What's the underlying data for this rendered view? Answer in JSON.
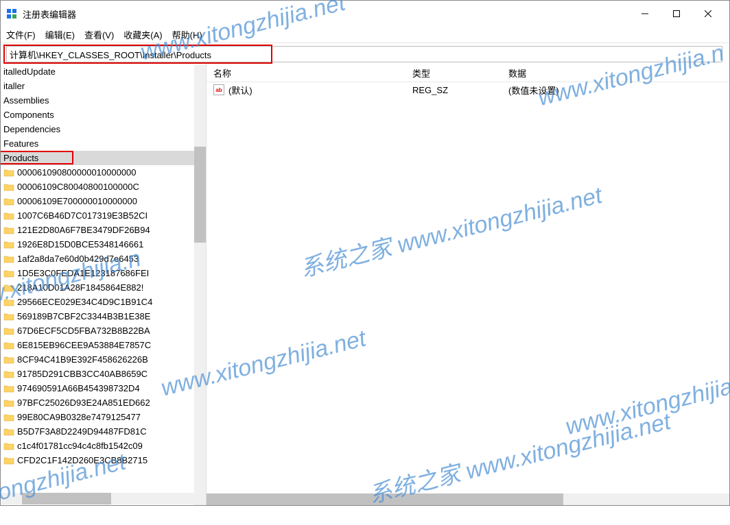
{
  "window": {
    "title": "注册表编辑器"
  },
  "menus": {
    "file": "文件(F)",
    "edit": "编辑(E)",
    "view": "查看(V)",
    "fav": "收藏夹(A)",
    "help": "帮助(H)"
  },
  "address": "计算机\\HKEY_CLASSES_ROOT\\Installer\\Products",
  "tree": {
    "top_partial1": "italledUpdate",
    "top_partial2": "italler",
    "items": [
      "Assemblies",
      "Components",
      "Dependencies",
      "Features",
      "Products"
    ],
    "children": [
      "000061090800000010000000",
      "00006109C80040800100000C",
      "00006109E700000010000000",
      "1007C6B46D7C017319E3B52CI",
      "121E2D80A6F7BE3479DF26B94",
      "1926E8D15D0BCE5348146661",
      "1af2a8da7e60d0b429d7e6453",
      "1D5E3C0FEDA1E123187686FEI",
      "218A10D01A28F1845864E882!",
      "29566ECE029E34C4D9C1B91C4",
      "569189B7CBF2C3344B3B1E38E",
      "67D6ECF5CD5FBA732B8B22BA",
      "6E815EB96CEE9A53884E7857C",
      "8CF94C41B9E392F458626226B",
      "91785D291CBB3CC40AB8659C",
      "974690591A66B454398732D4",
      "97BFC25026D93E24A851ED662",
      "99E80CA9B0328e7479125477",
      "B5D7F3A8D2249D94487FD81C",
      "c1c4f01781cc94c4c8fb1542c09",
      "CFD2C1F142D260E3CB8B2715"
    ]
  },
  "columns": {
    "name": "名称",
    "type": "类型",
    "data": "数据"
  },
  "rows": [
    {
      "name": "(默认)",
      "type": "REG_SZ",
      "data": "(数值未设置)"
    }
  ],
  "watermark": {
    "cn": "系统之家",
    "url": "www.xitongzhijia.net",
    "url2": "www.xitongzhijia.n"
  }
}
